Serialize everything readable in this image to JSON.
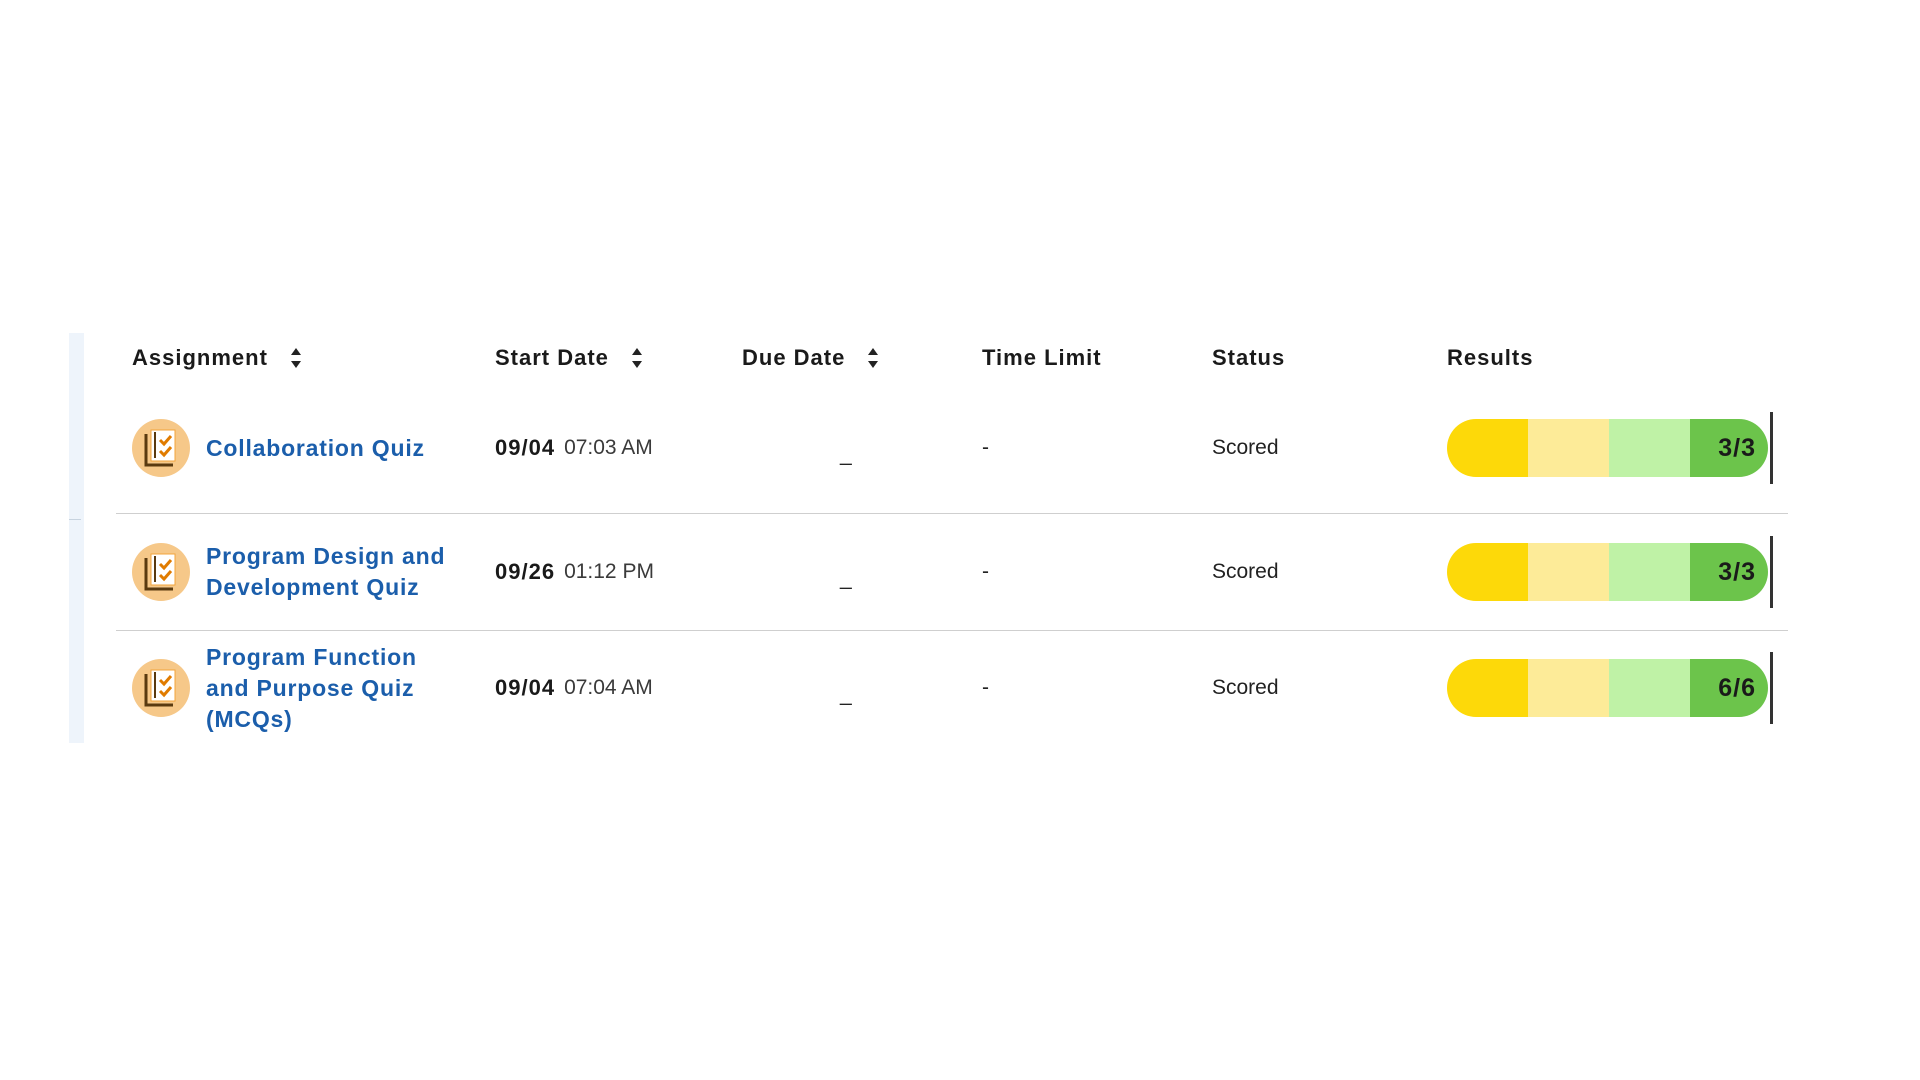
{
  "table": {
    "headers": {
      "assignment": "Assignment",
      "start_date": "Start Date",
      "due_date": "Due Date",
      "time_limit": "Time Limit",
      "status": "Status",
      "results": "Results"
    },
    "rows": [
      {
        "title": "Collaboration Quiz",
        "start_date": "09/04",
        "start_time": "07:03 AM",
        "due_date": "_",
        "time_limit": "-",
        "status": "Scored",
        "result": "3/3"
      },
      {
        "title": "Program Design and Development Quiz",
        "start_date": "09/26",
        "start_time": "01:12 PM",
        "due_date": "_",
        "time_limit": "-",
        "status": "Scored",
        "result": "3/3"
      },
      {
        "title": "Program Function and Purpose Quiz (MCQs)",
        "start_date": "09/04",
        "start_time": "07:04 AM",
        "due_date": "_",
        "time_limit": "-",
        "status": "Scored",
        "result": "6/6"
      }
    ]
  },
  "icons": {
    "sort": "sort-icon",
    "quiz": "quiz-checklist-icon"
  },
  "colors": {
    "link": "#1b5eab",
    "quiz_icon_bg": "#f6c889",
    "bar_segments": [
      "#fdd909",
      "#fdeb98",
      "#bff2a6",
      "#6cc44b"
    ]
  }
}
